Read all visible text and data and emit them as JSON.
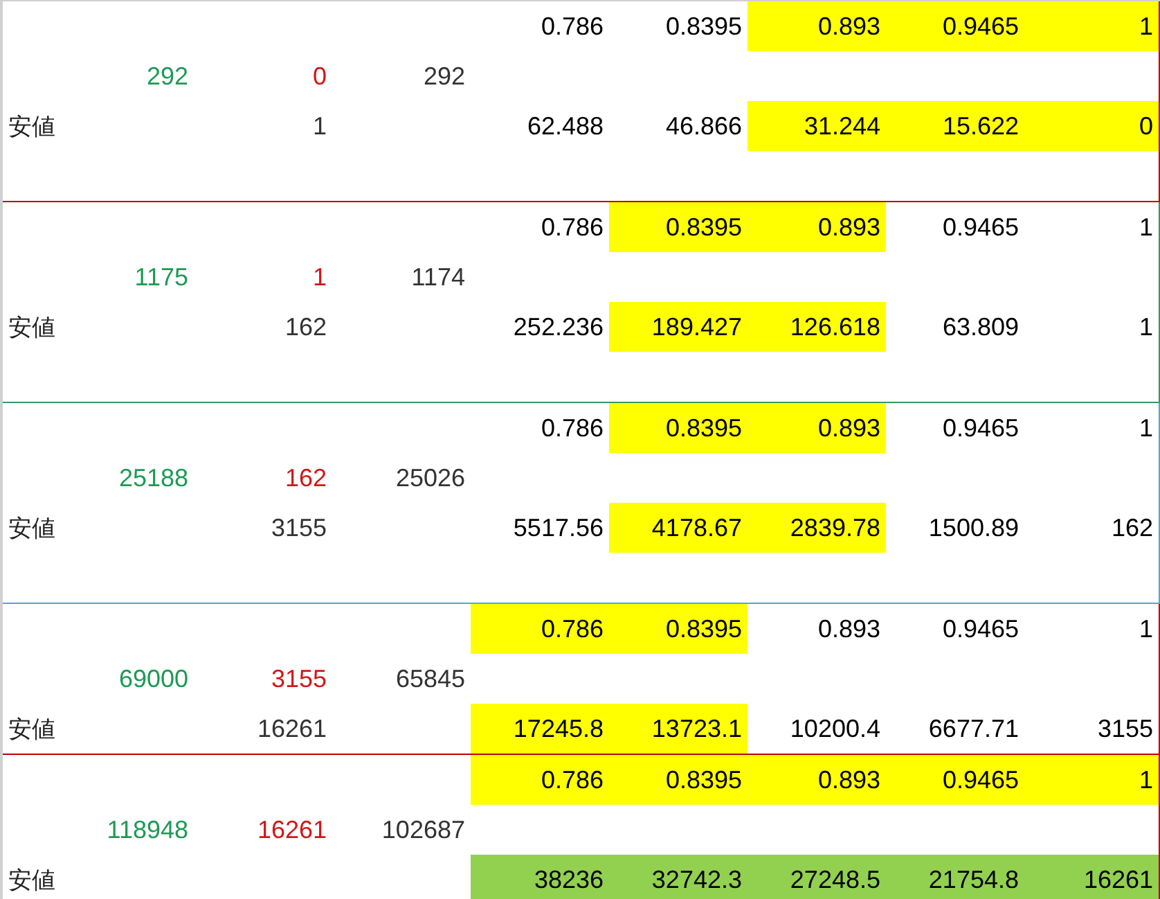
{
  "blocks": [
    {
      "color": "#c00000",
      "rows": [
        {
          "kind": "ratios",
          "cells": [
            {
              "text": "0.786"
            },
            {
              "text": "0.8395"
            },
            {
              "text": "0.893",
              "color": "#ffff00"
            },
            {
              "text": "0.9465",
              "color": "#ffff00"
            },
            {
              "text": "1",
              "color": "#ffff00"
            }
          ]
        },
        {
          "kind": "counts",
          "total": "292",
          "removed": "0",
          "remaining": "292"
        },
        {
          "kind": "low",
          "label": "安値",
          "base": "1",
          "cells": [
            {
              "text": "62.488"
            },
            {
              "text": "46.866"
            },
            {
              "text": "31.244",
              "color": "#ffff00"
            },
            {
              "text": "15.622",
              "color": "#ffff00"
            },
            {
              "text": "0",
              "color": "#ffff00"
            }
          ]
        },
        {
          "kind": "blank"
        }
      ]
    },
    {
      "color": "#339966",
      "rows": [
        {
          "kind": "ratios",
          "cells": [
            {
              "text": "0.786"
            },
            {
              "text": "0.8395",
              "color": "#ffff00"
            },
            {
              "text": "0.893",
              "color": "#ffff00"
            },
            {
              "text": "0.9465"
            },
            {
              "text": "1"
            }
          ]
        },
        {
          "kind": "counts",
          "total": "1175",
          "removed": "1",
          "remaining": "1174"
        },
        {
          "kind": "low",
          "label": "安値",
          "base": "162",
          "cells": [
            {
              "text": "252.236"
            },
            {
              "text": "189.427",
              "color": "#ffff00"
            },
            {
              "text": "126.618",
              "color": "#ffff00"
            },
            {
              "text": "63.809"
            },
            {
              "text": "1"
            }
          ]
        },
        {
          "kind": "blank"
        }
      ]
    },
    {
      "color": "#4bacc6",
      "rows": [
        {
          "kind": "ratios",
          "cells": [
            {
              "text": "0.786"
            },
            {
              "text": "0.8395",
              "color": "#ffff00"
            },
            {
              "text": "0.893",
              "color": "#ffff00"
            },
            {
              "text": "0.9465"
            },
            {
              "text": "1"
            }
          ]
        },
        {
          "kind": "counts",
          "total": "25188",
          "removed": "162",
          "remaining": "25026"
        },
        {
          "kind": "low",
          "label": "安値",
          "base": "3155",
          "cells": [
            {
              "text": "5517.56"
            },
            {
              "text": "4178.67",
              "color": "#ffff00"
            },
            {
              "text": "2839.78",
              "color": "#ffff00"
            },
            {
              "text": "1500.89"
            },
            {
              "text": "162"
            }
          ]
        },
        {
          "kind": "blank"
        }
      ]
    },
    {
      "color": "#c00000",
      "rows": [
        {
          "kind": "ratios",
          "cells": [
            {
              "text": "0.786",
              "color": "#ffff00"
            },
            {
              "text": "0.8395",
              "color": "#ffff00"
            },
            {
              "text": "0.893"
            },
            {
              "text": "0.9465"
            },
            {
              "text": "1"
            }
          ]
        },
        {
          "kind": "counts",
          "total": "69000",
          "removed": "3155",
          "remaining": "65845"
        },
        {
          "kind": "low",
          "label": "安値",
          "base": "16261",
          "cells": [
            {
              "text": "17245.8",
              "color": "#ffff00"
            },
            {
              "text": "13723.1",
              "color": "#ffff00"
            },
            {
              "text": "10200.4"
            },
            {
              "text": "6677.71"
            },
            {
              "text": "3155"
            }
          ]
        }
      ]
    },
    {
      "color": "#c00000",
      "rows": [
        {
          "kind": "ratios",
          "cells": [
            {
              "text": "0.786",
              "color": "#ffff00"
            },
            {
              "text": "0.8395",
              "color": "#ffff00"
            },
            {
              "text": "0.893",
              "color": "#ffff00"
            },
            {
              "text": "0.9465",
              "color": "#ffff00"
            },
            {
              "text": "1",
              "color": "#ffff00"
            }
          ]
        },
        {
          "kind": "counts",
          "total": "118948",
          "removed": "16261",
          "remaining": "102687"
        },
        {
          "kind": "low",
          "label": "安値",
          "cells": [
            {
              "text": "38236",
              "color": "#92d050"
            },
            {
              "text": "32742.3",
              "color": "#92d050"
            },
            {
              "text": "27248.5",
              "color": "#92d050"
            },
            {
              "text": "21754.8",
              "color": "#92d050"
            },
            {
              "text": "16261",
              "color": "#92d050"
            }
          ]
        }
      ]
    }
  ]
}
